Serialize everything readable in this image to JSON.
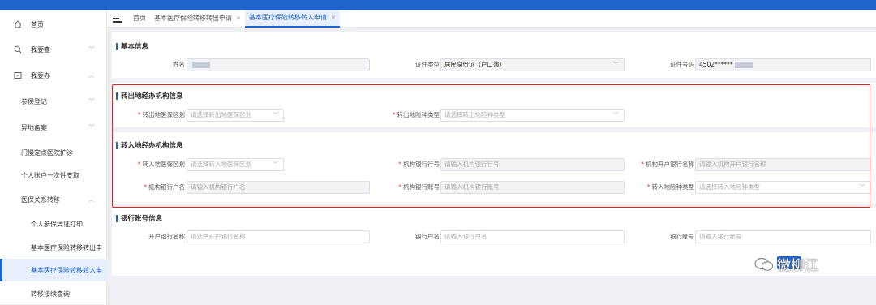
{
  "sidebar": {
    "items": [
      {
        "label": "首页",
        "icon": "home-icon"
      },
      {
        "label": "我要查",
        "icon": "search-icon"
      },
      {
        "label": "我要办",
        "icon": "task-icon"
      },
      {
        "label": "参保登记"
      },
      {
        "label": "异地备案"
      },
      {
        "label": "门慢定点医院扩诊"
      },
      {
        "label": "个人账户一次性支取"
      },
      {
        "label": "医保关系转移"
      },
      {
        "label": "个人参保凭证打印"
      },
      {
        "label": "基本医疗保险转移转出申"
      },
      {
        "label": "基本医疗保险转移转入申"
      },
      {
        "label": "转移接续查询"
      }
    ]
  },
  "tabs": [
    {
      "label": "首页"
    },
    {
      "label": "基本医疗保险转移转出申请"
    },
    {
      "label": "基本医疗保险转移转入申请"
    }
  ],
  "basic": {
    "title": "基本信息",
    "name_label": "姓名",
    "id_type_label": "证件类型",
    "id_type_value": "居民身份证（户口簿）",
    "id_no_label": "证件号码",
    "id_no_value": "4502******"
  },
  "out_section": {
    "title": "转出地经办机构信息",
    "region_label": "转出地医保区划",
    "region_placeholder": "请选择转出地医保区划",
    "type_label": "转出地险种类型",
    "type_placeholder": "请选择转出地险种类型"
  },
  "in_section": {
    "title": "转入地经办机构信息",
    "region_label": "转入地医保区划",
    "region_placeholder": "请选择转入地医保区划",
    "bank_no_label": "机构银行行号",
    "bank_no_placeholder": "请输入机构银行行号",
    "bank_name_label": "机构开户银行名称",
    "bank_name_placeholder": "请输入机构开户银行名称",
    "acct_name_label": "机构银行户名",
    "acct_name_placeholder": "请输入机构银行户名",
    "acct_no_label": "机构银行账号",
    "acct_no_placeholder": "请输入机构银行账号",
    "type_label": "转入地险种类型",
    "type_placeholder": "请选择转入地险种类型"
  },
  "bank_section": {
    "title": "银行账号信息",
    "bank_label": "开户银行名称",
    "bank_placeholder": "请选择开户银行名称",
    "acct_name_label": "银行户名",
    "acct_name_placeholder": "请输入银行户名",
    "acct_no_label": "银行账号",
    "acct_no_placeholder": "请输入银行账号"
  },
  "watermark": {
    "text": "微柳江"
  },
  "colors": {
    "primary": "#1f64c8",
    "highlight_box": "#e02424",
    "required": "#e23c3c"
  }
}
